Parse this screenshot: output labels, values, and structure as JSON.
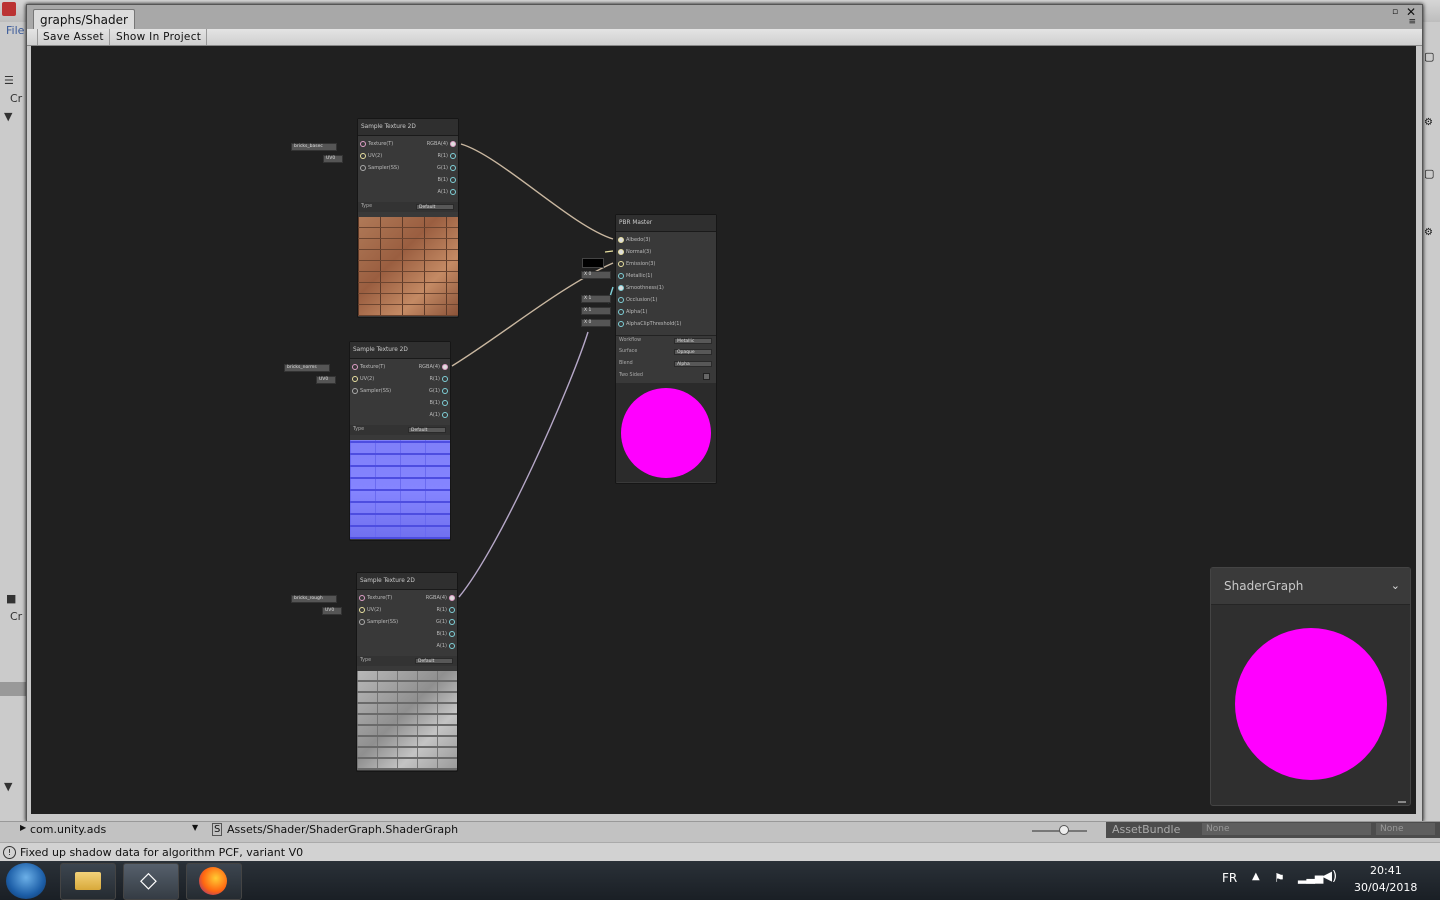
{
  "editor": {
    "menu_file": "File",
    "left_labels": [
      "Cr",
      "Cr"
    ],
    "package_item": "com.unity.ads",
    "asset_path": "Assets/Shader/ShaderGraph.ShaderGraph",
    "assetbundle_label": "AssetBundle",
    "assetbundle_value": "None",
    "assetbundle_variant": "None",
    "status_message": "Fixed up shadow data for algorithm PCF, variant V0"
  },
  "window": {
    "tab_title": "graphs/Shader",
    "toolbar": {
      "save_asset": "Save Asset",
      "show_in_project": "Show In Project"
    }
  },
  "nodes": {
    "tex_albedo": {
      "title": "Sample Texture 2D",
      "input_texture": "bricks_basec",
      "input_uv": "UV0",
      "inputs": [
        "Texture(T)",
        "UV(2)",
        "Sampler(SS)"
      ],
      "outputs": [
        "RGBA(4)",
        "R(1)",
        "G(1)",
        "B(1)",
        "A(1)"
      ],
      "type_label": "Type",
      "type_value": "Default"
    },
    "tex_normal": {
      "title": "Sample Texture 2D",
      "input_texture": "bricks_norms",
      "input_uv": "UV0",
      "inputs": [
        "Texture(T)",
        "UV(2)",
        "Sampler(SS)"
      ],
      "outputs": [
        "RGBA(4)",
        "R(1)",
        "G(1)",
        "B(1)",
        "A(1)"
      ],
      "type_label": "Type",
      "type_value": "Default"
    },
    "tex_rough": {
      "title": "Sample Texture 2D",
      "input_texture": "bricks_rough",
      "input_uv": "UV0",
      "inputs": [
        "Texture(T)",
        "UV(2)",
        "Sampler(SS)"
      ],
      "outputs": [
        "RGBA(4)",
        "R(1)",
        "G(1)",
        "B(1)",
        "A(1)"
      ],
      "type_label": "Type",
      "type_value": "Default"
    },
    "pbr_master": {
      "title": "PBR Master",
      "inputs": [
        "Albedo(3)",
        "Normal(3)",
        "Emission(3)",
        "Metallic(1)",
        "Smoothness(1)",
        "Occlusion(1)",
        "Alpha(1)",
        "AlphaClipThreshold(1)"
      ],
      "input_values": [
        "X 0",
        "X 1",
        "X 1",
        "X 0"
      ],
      "options": [
        {
          "label": "Workflow",
          "value": "Metallic"
        },
        {
          "label": "Surface",
          "value": "Opaque"
        },
        {
          "label": "Blend",
          "value": "Alpha"
        },
        {
          "label": "Two Sided",
          "value": ""
        }
      ],
      "preview_color": "#ff00ff"
    }
  },
  "preview": {
    "title": "ShaderGraph",
    "color": "#ff00ff"
  },
  "taskbar": {
    "lang": "FR",
    "time": "20:41",
    "date": "30/04/2018"
  }
}
